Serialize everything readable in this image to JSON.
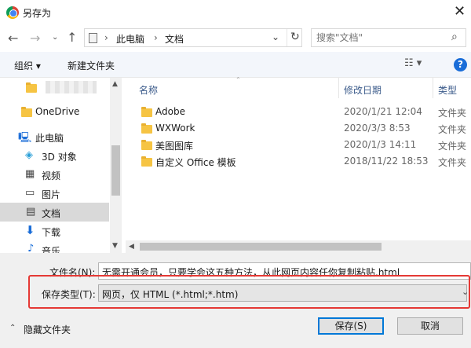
{
  "window": {
    "title": "另存为"
  },
  "nav": {
    "address": {
      "crumbs": [
        "此电脑",
        "文档"
      ],
      "separator": "›"
    },
    "search_placeholder": "搜索\"文档\""
  },
  "toolbar": {
    "organize_label": "组织 ▾",
    "new_folder_label": "新建文件夹",
    "help_label": "?"
  },
  "sidebar": {
    "items": [
      {
        "label": "OneDrive"
      },
      {
        "label": "此电脑"
      },
      {
        "label": "3D 对象"
      },
      {
        "label": "视频"
      },
      {
        "label": "图片"
      },
      {
        "label": "文档",
        "selected": true
      },
      {
        "label": "下载"
      },
      {
        "label": "音乐"
      }
    ]
  },
  "file_list": {
    "columns": {
      "name": "名称",
      "date": "修改日期",
      "type": "类型"
    },
    "rows": [
      {
        "name": "Adobe",
        "date": "2020/1/21 12:04",
        "type": "文件夹"
      },
      {
        "name": "WXWork",
        "date": "2020/3/3 8:53",
        "type": "文件夹"
      },
      {
        "name": "美图图库",
        "date": "2020/1/3 14:11",
        "type": "文件夹"
      },
      {
        "name": "自定义 Office 模板",
        "date": "2018/11/22 18:53",
        "type": "文件夹"
      }
    ]
  },
  "form": {
    "filename_label": "文件名(N):",
    "filename_value": "无需开通会员，只要学会这五种方法，从此网页内容任你复制粘贴.html",
    "filetype_label": "保存类型(T):",
    "filetype_value": "网页，仅 HTML (*.html;*.htm)"
  },
  "footer": {
    "hide_folders_label": "隐藏文件夹",
    "save_label": "保存(S)",
    "cancel_label": "取消"
  },
  "colors": {
    "highlight_box": "#e53935",
    "accent": "#0078d7"
  }
}
